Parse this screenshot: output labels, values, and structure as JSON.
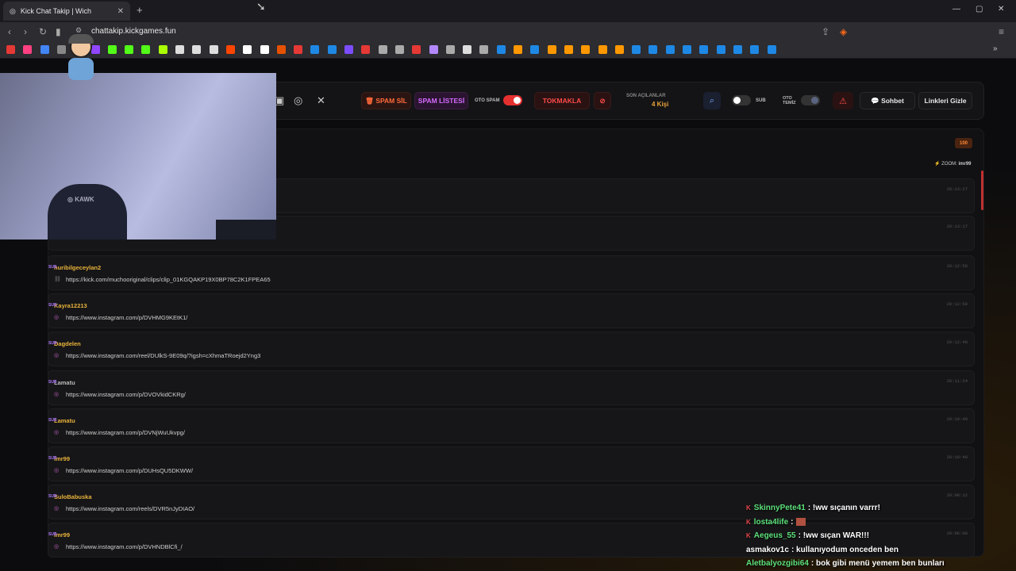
{
  "browser": {
    "tab_title": "Kick Chat Takip | Wich",
    "tab_close": "✕",
    "new_tab": "+",
    "url": "chattakip.kickgames.fun",
    "window_controls": [
      "—",
      "▢",
      "✕"
    ]
  },
  "toolbar": {
    "spam_sil": "SPAM SİL",
    "spam_listesi": "SPAM LİSTESİ",
    "oto_spam_label": "OTO SPAM",
    "oto_spam_on": true,
    "tokmakla": "TOKMAKLA",
    "son_acilanlar_label": "SON AÇILANLAR",
    "son_acilanlar_count": "4 Kişi",
    "sub_label": "SUB",
    "sub_on": false,
    "oto_temiz_label_1": "OTO",
    "oto_temiz_label_2": "TEMİZ",
    "oto_temiz_on": false,
    "sohbet": "Sohbet",
    "linkleri_gizle": "Linkleri Gizle",
    "accent_red": "#e53030",
    "accent_orange": "#ff6a3a",
    "accent_purple": "#d56cff"
  },
  "panel": {
    "badge": "100",
    "zoom_label": "ZOOM",
    "zoom_user": "imr99"
  },
  "rows": [
    {
      "user": "nuribilgeceylan2",
      "sub": "SUB",
      "link": "https://kick.com/muchooriginal/clips/clip_01KGQAKP19X0BP78C2K1FPEA65",
      "time": "20:12:56",
      "icon": "link-icon",
      "color": "#e8b23a"
    },
    {
      "user": "Kayra12213",
      "sub": "SUB",
      "link": "https://www.instagram.com/p/DVHMG9KEtK1/",
      "time": "20:12:50",
      "icon": "instagram-icon",
      "color": "#e8b23a"
    },
    {
      "user": "Dagdelen",
      "sub": "SUB",
      "link": "https://www.instagram.com/reel/DUlkS-9E09q/?igsh=cXhmaTRoejd2Yng3",
      "time": "20:12:48",
      "icon": "instagram-icon",
      "color": "#e8b23a"
    },
    {
      "user": "Lamatu",
      "sub": "SUB",
      "link": "https://www.instagram.com/p/DVOVkidCKRg/",
      "time": "20:11:24",
      "icon": "instagram-icon",
      "color": "#bbbbbb"
    },
    {
      "user": "Lamatu",
      "sub": "SUB",
      "link": "https://www.instagram.com/p/DVNjWuUkvpg/",
      "time": "20:10:40",
      "icon": "instagram-icon",
      "color": "#e8b23a"
    },
    {
      "user": "imr99",
      "sub": "SUB",
      "link": "https://www.instagram.com/p/DUHsQU5DKWW/",
      "time": "20:10:40",
      "icon": "instagram-icon",
      "color": "#e8b23a"
    },
    {
      "user": "SuloBabuska",
      "sub": "SUB",
      "link": "https://www.instagram.com/reels/DVR5nJyDIAO/",
      "time": "20:08:12",
      "icon": "instagram-icon",
      "color": "#e8b23a"
    },
    {
      "user": "imr99",
      "sub": "SUB",
      "link": "https://www.instagram.com/p/DVHNDBlCfi_/",
      "time": "20:06:08",
      "icon": "instagram-icon",
      "color": "#e8b23a"
    }
  ],
  "hidden_row_times": [
    "20:13:27",
    "20:13:17"
  ],
  "stream_chat": [
    {
      "badge": "K",
      "name": "SkinnyPete41",
      "name_color": "#5ce07a",
      "msg": ": !ww sıçanın varrr!"
    },
    {
      "badge": "K",
      "name": "losta4life",
      "name_color": "#5ce07a",
      "msg": ":"
    },
    {
      "badge": "K",
      "name": "Aegeus_55",
      "name_color": "#5ce07a",
      "msg": ": !ww sıçan WAR!!!"
    },
    {
      "badge": "",
      "name": "asmakov1c",
      "name_color": "#ffffff",
      "msg": ": kullanıyodum onceden ben"
    },
    {
      "badge": "",
      "name": "Aletbalyozgibi64",
      "name_color": "#5ce07a",
      "msg": ": bok gibi menü yemem ben bunları"
    }
  ]
}
